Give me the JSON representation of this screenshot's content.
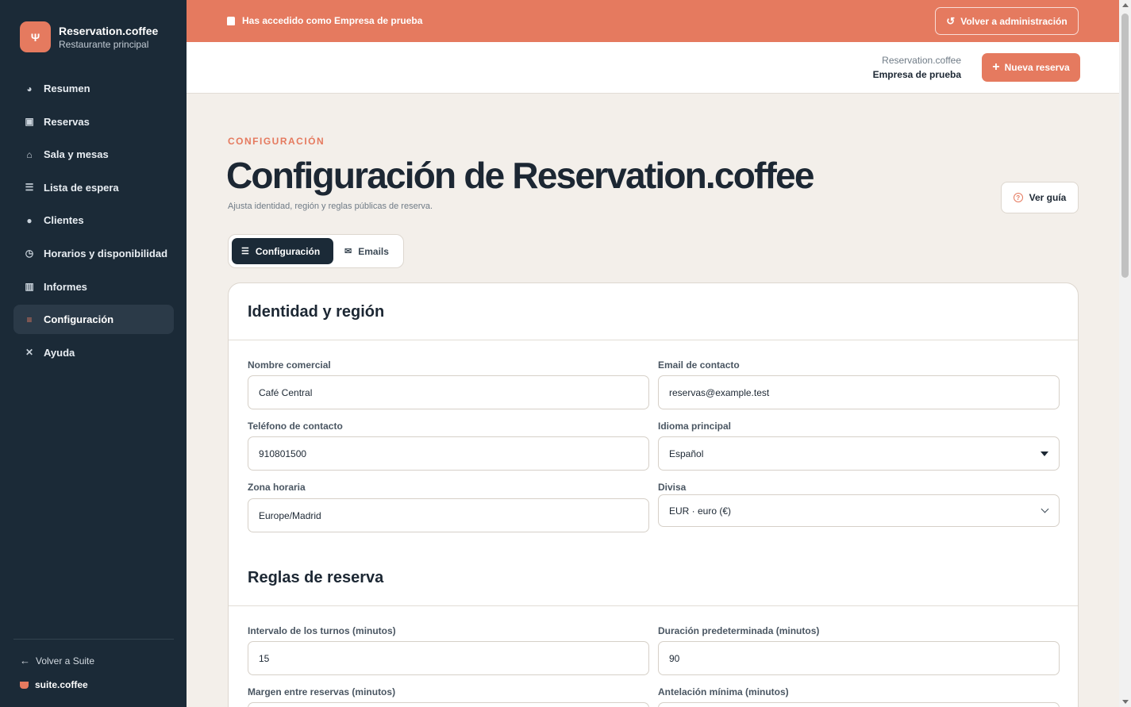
{
  "brand": {
    "name": "Reservation.coffee",
    "subtitle": "Restaurante principal",
    "logo_icon": "fork-knife-icon"
  },
  "sidebar": {
    "items": [
      {
        "label": "Resumen",
        "icon": "pie-chart-icon",
        "glyph": "◕"
      },
      {
        "label": "Reservas",
        "icon": "calendar-icon",
        "glyph": "▣"
      },
      {
        "label": "Sala y mesas",
        "icon": "chair-icon",
        "glyph": "⌂"
      },
      {
        "label": "Lista de espera",
        "icon": "list-icon",
        "glyph": "☰"
      },
      {
        "label": "Clientes",
        "icon": "users-icon",
        "glyph": "●"
      },
      {
        "label": "Horarios y disponibilidad",
        "icon": "clock-icon",
        "glyph": "◷"
      },
      {
        "label": "Informes",
        "icon": "bar-chart-icon",
        "glyph": "▥"
      },
      {
        "label": "Configuración",
        "icon": "sliders-icon",
        "glyph": "≡",
        "active": true
      },
      {
        "label": "Ayuda",
        "icon": "help-circle-icon",
        "glyph": "✕"
      }
    ],
    "back_label": "Volver a Suite",
    "suite_brand": "suite.coffee"
  },
  "banner": {
    "text": "Has accedido como Empresa de prueba",
    "button_label": "Volver a administración",
    "color": "#e57a5f"
  },
  "header": {
    "account_app": "Reservation.coffee",
    "account_company": "Empresa de prueba",
    "new_button_label": "Nueva reserva"
  },
  "page": {
    "eyebrow": "CONFIGURACIÓN",
    "title": "Configuración de Reservation.coffee",
    "subtitle": "Ajusta identidad, región y reglas públicas de reserva.",
    "guide_button": "Ver guía"
  },
  "tabs": [
    {
      "label": "Configuración",
      "icon": "sliders-icon",
      "active": true
    },
    {
      "label": "Emails",
      "icon": "mail-icon",
      "active": false
    }
  ],
  "identity": {
    "title": "Identidad y región",
    "fields": {
      "business_name": {
        "label": "Nombre comercial",
        "value": "Café Central"
      },
      "contact_email": {
        "label": "Email de contacto",
        "value": "reservas@example.test"
      },
      "contact_phone": {
        "label": "Teléfono de contacto",
        "value": "910801500"
      },
      "language": {
        "label": "Idioma principal",
        "value": "Español"
      },
      "timezone": {
        "label": "Zona horaria",
        "value": "Europe/Madrid"
      },
      "currency": {
        "label": "Divisa",
        "value": "EUR · euro (€)"
      }
    }
  },
  "rules": {
    "title": "Reglas de reserva",
    "fields": {
      "slot_interval": {
        "label": "Intervalo de los turnos (minutos)",
        "value": "15"
      },
      "default_duration": {
        "label": "Duración predeterminada (minutos)",
        "value": "90"
      },
      "buffer": {
        "label": "Margen entre reservas (minutos)",
        "value": ""
      },
      "min_notice": {
        "label": "Antelación mínima (minutos)",
        "value": ""
      }
    }
  },
  "colors": {
    "accent": "#e57a5f",
    "sidebar": "#1b2a37",
    "background": "#f3efea"
  }
}
